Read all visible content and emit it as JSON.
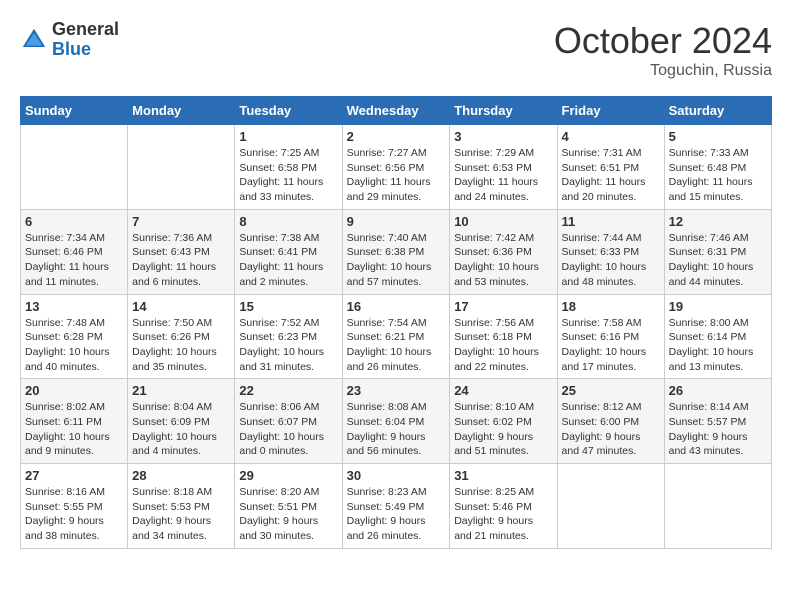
{
  "logo": {
    "general": "General",
    "blue": "Blue"
  },
  "title": "October 2024",
  "subtitle": "Toguchin, Russia",
  "days_of_week": [
    "Sunday",
    "Monday",
    "Tuesday",
    "Wednesday",
    "Thursday",
    "Friday",
    "Saturday"
  ],
  "weeks": [
    [
      {
        "day": "",
        "info": ""
      },
      {
        "day": "",
        "info": ""
      },
      {
        "day": "1",
        "info": "Sunrise: 7:25 AM\nSunset: 6:58 PM\nDaylight: 11 hours and 33 minutes."
      },
      {
        "day": "2",
        "info": "Sunrise: 7:27 AM\nSunset: 6:56 PM\nDaylight: 11 hours and 29 minutes."
      },
      {
        "day": "3",
        "info": "Sunrise: 7:29 AM\nSunset: 6:53 PM\nDaylight: 11 hours and 24 minutes."
      },
      {
        "day": "4",
        "info": "Sunrise: 7:31 AM\nSunset: 6:51 PM\nDaylight: 11 hours and 20 minutes."
      },
      {
        "day": "5",
        "info": "Sunrise: 7:33 AM\nSunset: 6:48 PM\nDaylight: 11 hours and 15 minutes."
      }
    ],
    [
      {
        "day": "6",
        "info": "Sunrise: 7:34 AM\nSunset: 6:46 PM\nDaylight: 11 hours and 11 minutes."
      },
      {
        "day": "7",
        "info": "Sunrise: 7:36 AM\nSunset: 6:43 PM\nDaylight: 11 hours and 6 minutes."
      },
      {
        "day": "8",
        "info": "Sunrise: 7:38 AM\nSunset: 6:41 PM\nDaylight: 11 hours and 2 minutes."
      },
      {
        "day": "9",
        "info": "Sunrise: 7:40 AM\nSunset: 6:38 PM\nDaylight: 10 hours and 57 minutes."
      },
      {
        "day": "10",
        "info": "Sunrise: 7:42 AM\nSunset: 6:36 PM\nDaylight: 10 hours and 53 minutes."
      },
      {
        "day": "11",
        "info": "Sunrise: 7:44 AM\nSunset: 6:33 PM\nDaylight: 10 hours and 48 minutes."
      },
      {
        "day": "12",
        "info": "Sunrise: 7:46 AM\nSunset: 6:31 PM\nDaylight: 10 hours and 44 minutes."
      }
    ],
    [
      {
        "day": "13",
        "info": "Sunrise: 7:48 AM\nSunset: 6:28 PM\nDaylight: 10 hours and 40 minutes."
      },
      {
        "day": "14",
        "info": "Sunrise: 7:50 AM\nSunset: 6:26 PM\nDaylight: 10 hours and 35 minutes."
      },
      {
        "day": "15",
        "info": "Sunrise: 7:52 AM\nSunset: 6:23 PM\nDaylight: 10 hours and 31 minutes."
      },
      {
        "day": "16",
        "info": "Sunrise: 7:54 AM\nSunset: 6:21 PM\nDaylight: 10 hours and 26 minutes."
      },
      {
        "day": "17",
        "info": "Sunrise: 7:56 AM\nSunset: 6:18 PM\nDaylight: 10 hours and 22 minutes."
      },
      {
        "day": "18",
        "info": "Sunrise: 7:58 AM\nSunset: 6:16 PM\nDaylight: 10 hours and 17 minutes."
      },
      {
        "day": "19",
        "info": "Sunrise: 8:00 AM\nSunset: 6:14 PM\nDaylight: 10 hours and 13 minutes."
      }
    ],
    [
      {
        "day": "20",
        "info": "Sunrise: 8:02 AM\nSunset: 6:11 PM\nDaylight: 10 hours and 9 minutes."
      },
      {
        "day": "21",
        "info": "Sunrise: 8:04 AM\nSunset: 6:09 PM\nDaylight: 10 hours and 4 minutes."
      },
      {
        "day": "22",
        "info": "Sunrise: 8:06 AM\nSunset: 6:07 PM\nDaylight: 10 hours and 0 minutes."
      },
      {
        "day": "23",
        "info": "Sunrise: 8:08 AM\nSunset: 6:04 PM\nDaylight: 9 hours and 56 minutes."
      },
      {
        "day": "24",
        "info": "Sunrise: 8:10 AM\nSunset: 6:02 PM\nDaylight: 9 hours and 51 minutes."
      },
      {
        "day": "25",
        "info": "Sunrise: 8:12 AM\nSunset: 6:00 PM\nDaylight: 9 hours and 47 minutes."
      },
      {
        "day": "26",
        "info": "Sunrise: 8:14 AM\nSunset: 5:57 PM\nDaylight: 9 hours and 43 minutes."
      }
    ],
    [
      {
        "day": "27",
        "info": "Sunrise: 8:16 AM\nSunset: 5:55 PM\nDaylight: 9 hours and 38 minutes."
      },
      {
        "day": "28",
        "info": "Sunrise: 8:18 AM\nSunset: 5:53 PM\nDaylight: 9 hours and 34 minutes."
      },
      {
        "day": "29",
        "info": "Sunrise: 8:20 AM\nSunset: 5:51 PM\nDaylight: 9 hours and 30 minutes."
      },
      {
        "day": "30",
        "info": "Sunrise: 8:23 AM\nSunset: 5:49 PM\nDaylight: 9 hours and 26 minutes."
      },
      {
        "day": "31",
        "info": "Sunrise: 8:25 AM\nSunset: 5:46 PM\nDaylight: 9 hours and 21 minutes."
      },
      {
        "day": "",
        "info": ""
      },
      {
        "day": "",
        "info": ""
      }
    ]
  ]
}
